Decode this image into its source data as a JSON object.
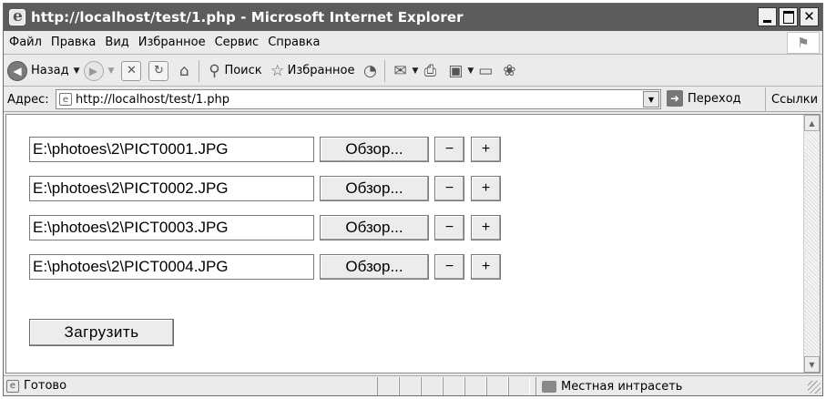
{
  "window": {
    "title": "http://localhost/test/1.php - Microsoft Internet Explorer"
  },
  "menu": [
    "Файл",
    "Правка",
    "Вид",
    "Избранное",
    "Сервис",
    "Справка"
  ],
  "toolbar": {
    "back_label": "Назад",
    "search_label": "Поиск",
    "favorites_label": "Избранное"
  },
  "address": {
    "label": "Адрес:",
    "url": "http://localhost/test/1.php",
    "go_label": "Переход",
    "links_label": "Ссылки"
  },
  "form": {
    "files": [
      {
        "value": "E:\\photoes\\2\\PICT0001.JPG"
      },
      {
        "value": "E:\\photoes\\2\\PICT0002.JPG"
      },
      {
        "value": "E:\\photoes\\2\\PICT0003.JPG"
      },
      {
        "value": "E:\\photoes\\2\\PICT0004.JPG"
      }
    ],
    "browse_label": "Обзор...",
    "minus_label": "−",
    "plus_label": "+",
    "upload_label": "Загрузить"
  },
  "status": {
    "text": "Готово",
    "zone": "Местная интрасеть"
  }
}
